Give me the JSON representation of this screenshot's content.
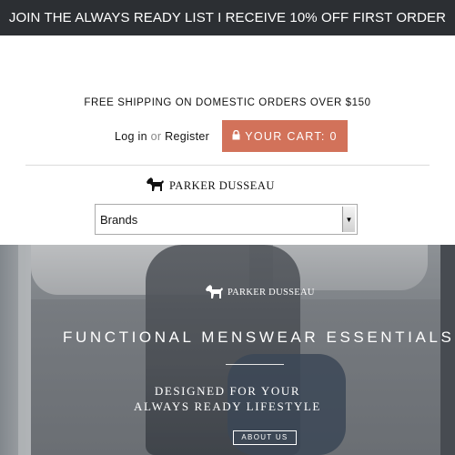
{
  "promo_banner": "JOIN THE ALWAYS READY LIST I RECEIVE 10% OFF FIRST ORDER",
  "shipping_notice": "FREE SHIPPING ON DOMESTIC ORDERS OVER $150",
  "account": {
    "login_label": "Log in",
    "or_text": "or",
    "register_label": "Register"
  },
  "cart": {
    "label": "YOUR CART: 0",
    "icon": "lock-icon",
    "color": "#d2725a"
  },
  "brand": {
    "name": "PARKER DUSSEAU",
    "icon": "dog-logo-icon"
  },
  "nav_select": {
    "selected": "Brands"
  },
  "hero": {
    "logo_text": "PARKER DUSSEAU",
    "headline": "FUNCTIONAL MENSWEAR ESSENTIALS",
    "subline1": "DESIGNED FOR YOUR",
    "subline2": "ALWAYS READY LIFESTYLE",
    "button_label": "ABOUT US"
  },
  "colors": {
    "banner_bg": "#2c2f33",
    "accent": "#d2725a"
  }
}
